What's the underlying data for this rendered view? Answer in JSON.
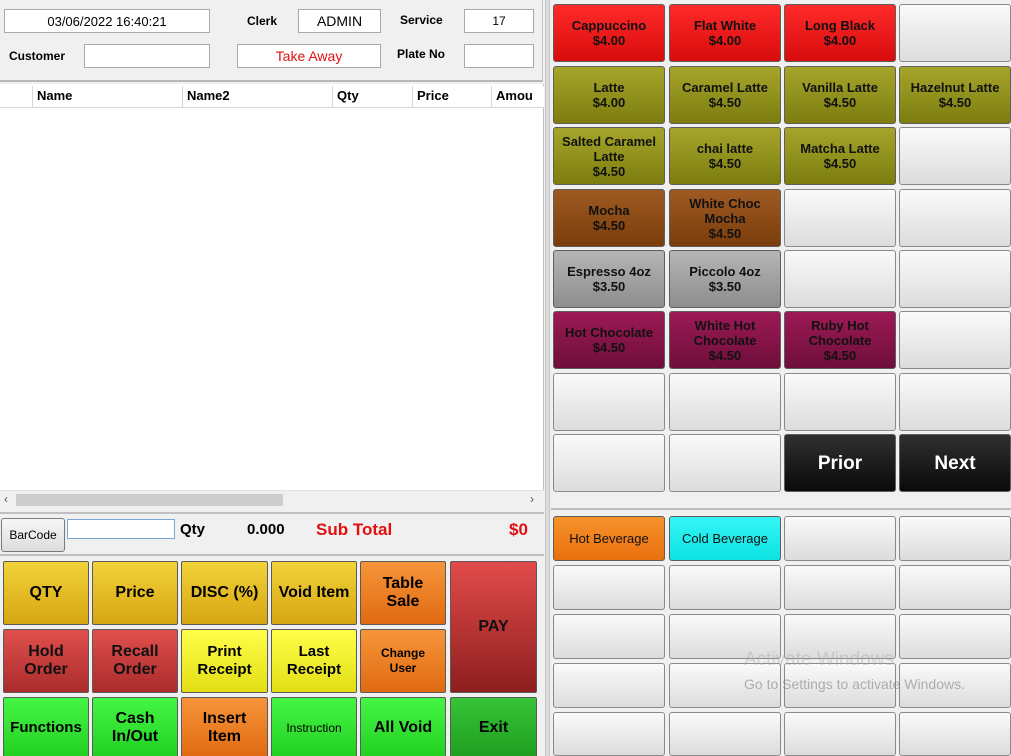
{
  "header": {
    "datetime": "03/06/2022 16:40:21",
    "clerk_label": "Clerk",
    "clerk_value": "ADMIN",
    "service_label": "Service",
    "service_value": "17",
    "customer_label": "Customer",
    "customer_value": "",
    "order_type": "Take Away",
    "plate_label": "Plate No",
    "plate_value": ""
  },
  "grid": {
    "columns": [
      "Name",
      "Name2",
      "Qty",
      "Price",
      "Amou"
    ]
  },
  "subtotal": {
    "barcode_button": "BarCode",
    "qty_label": "Qty",
    "qty_value": "0.000",
    "subtotal_label": "Sub Total",
    "subtotal_value": "$0"
  },
  "keys": {
    "qty": "QTY",
    "price": "Price",
    "disc": "DISC (%)",
    "void_item": "Void Item",
    "table_sale_1": "Table",
    "table_sale_2": "Sale",
    "pay": "PAY",
    "hold_1": "Hold",
    "hold_2": "Order",
    "recall_1": "Recall",
    "recall_2": "Order",
    "print_1": "Print",
    "print_2": "Receipt",
    "last_1": "Last",
    "last_2": "Receipt",
    "change_1": "Change",
    "change_2": "User",
    "functions": "Functions",
    "cash_1": "Cash",
    "cash_2": "In/Out",
    "insert_1": "Insert",
    "insert_2": "Item",
    "instruction": "Instruction",
    "all_void": "All Void",
    "exit": "Exit"
  },
  "products": [
    {
      "name": "Cappuccino",
      "price": "$4.00",
      "color": "#ff1a1a"
    },
    {
      "name": "Flat White",
      "price": "$4.00",
      "color": "#ff1a1a"
    },
    {
      "name": "Long Black",
      "price": "$4.00",
      "color": "#ff1a1a"
    },
    {
      "name": "",
      "price": ""
    },
    {
      "name": "Latte",
      "price": "$4.00",
      "color": "#8f8f1f"
    },
    {
      "name": "Caramel Latte",
      "price": "$4.50",
      "color": "#8f8f1f"
    },
    {
      "name": "Vanilla Latte",
      "price": "$4.50",
      "color": "#8f8f1f"
    },
    {
      "name": "Hazelnut Latte",
      "price": "$4.50",
      "color": "#8f8f1f"
    },
    {
      "name": "Salted Caramel Latte",
      "price": "$4.50",
      "color": "#8f8f1f"
    },
    {
      "name": "chai latte",
      "price": "$4.50",
      "color": "#8f8f1f"
    },
    {
      "name": "Matcha Latte",
      "price": "$4.50",
      "color": "#8f8f1f"
    },
    {
      "name": "",
      "price": ""
    },
    {
      "name": "Mocha",
      "price": "$4.50",
      "color": "#8b4a17"
    },
    {
      "name": "White Choc Mocha",
      "price": "$4.50",
      "color": "#8b4a17"
    },
    {
      "name": "",
      "price": ""
    },
    {
      "name": "",
      "price": ""
    },
    {
      "name": "Espresso 4oz",
      "price": "$3.50",
      "color": "#a0a0a0"
    },
    {
      "name": "Piccolo 4oz",
      "price": "$3.50",
      "color": "#a0a0a0"
    },
    {
      "name": "",
      "price": ""
    },
    {
      "name": "",
      "price": ""
    },
    {
      "name": "Hot Chocolate",
      "price": "$4.50",
      "color": "#861448"
    },
    {
      "name": "White Hot Chocolate",
      "price": "$4.50",
      "color": "#861448"
    },
    {
      "name": "Ruby Hot Chocolate",
      "price": "$4.50",
      "color": "#861448"
    },
    {
      "name": "",
      "price": ""
    }
  ],
  "nav": {
    "prior": "Prior",
    "next": "Next"
  },
  "categories": {
    "hot": "Hot Beverage",
    "cold": "Cold Beverage"
  },
  "watermark": {
    "title": "Activate Windows",
    "sub": "Go to Settings to activate Windows."
  }
}
